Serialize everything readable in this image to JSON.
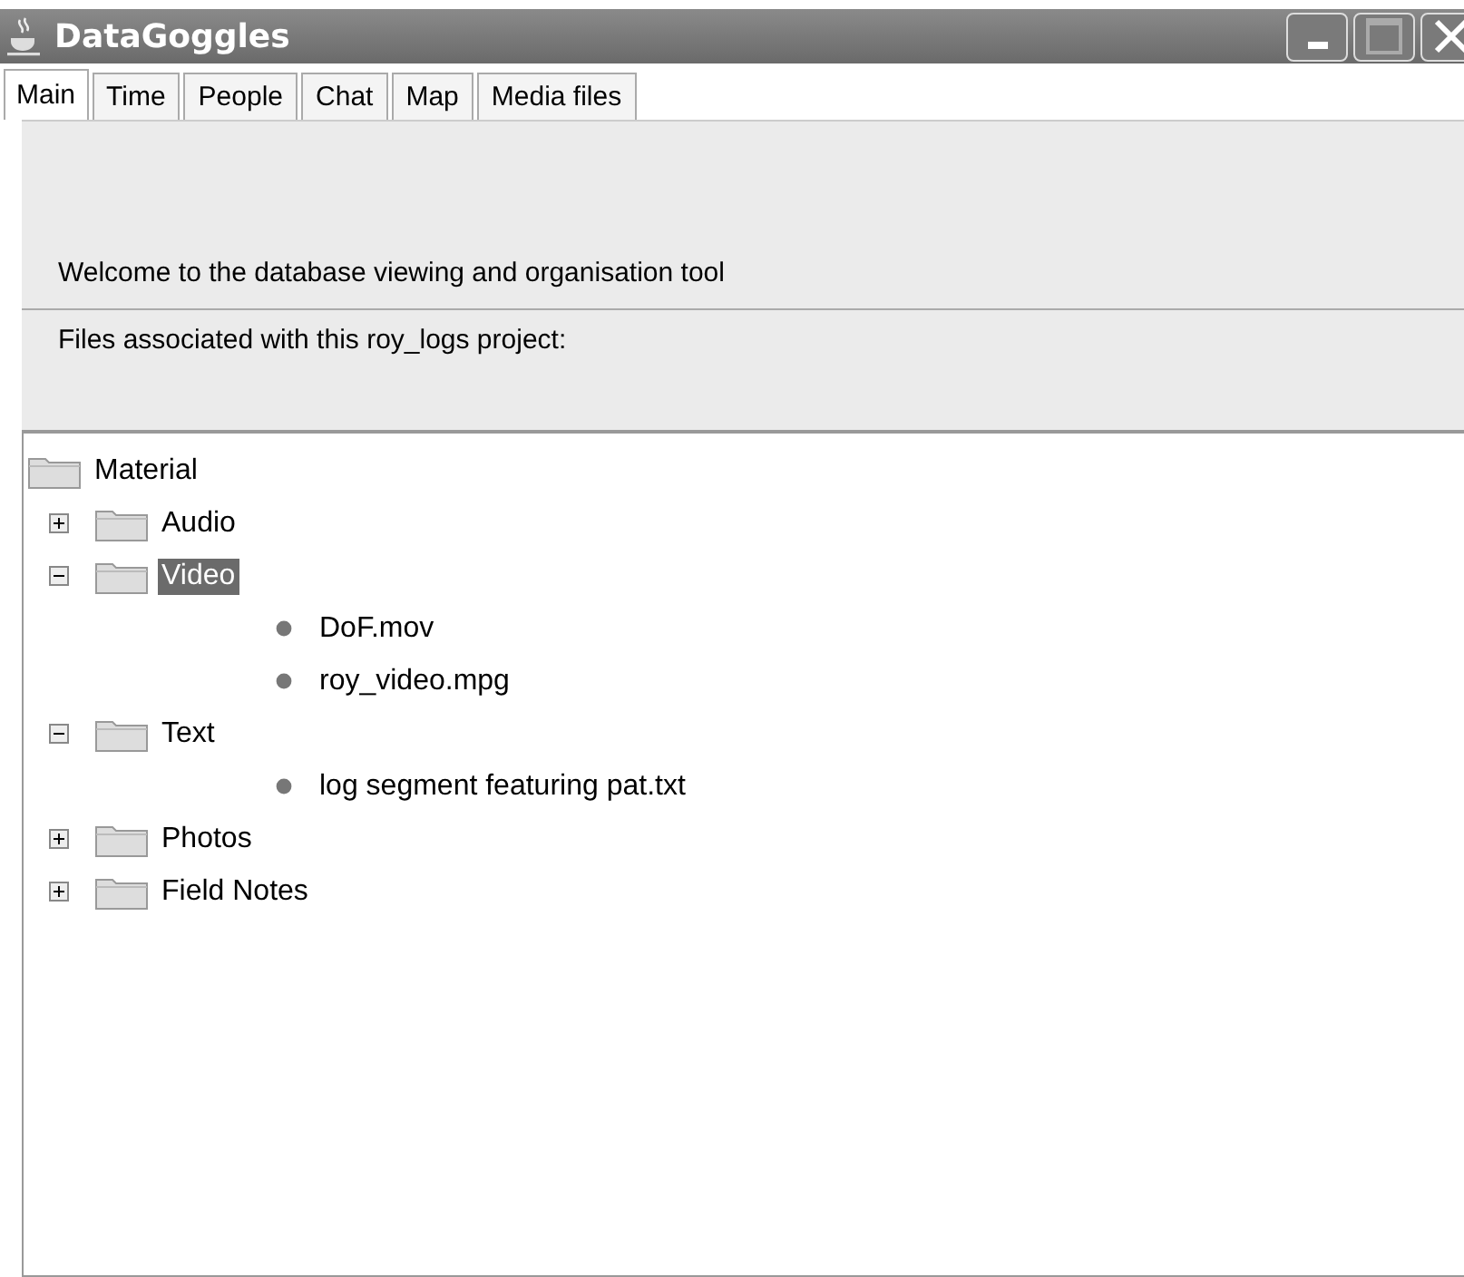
{
  "window": {
    "title": "DataGoggles"
  },
  "tabs": [
    {
      "label": "Main",
      "selected": true
    },
    {
      "label": "Time",
      "selected": false
    },
    {
      "label": "People",
      "selected": false
    },
    {
      "label": "Chat",
      "selected": false
    },
    {
      "label": "Map",
      "selected": false
    },
    {
      "label": "Media files",
      "selected": false
    }
  ],
  "panel": {
    "welcome": "Welcome to the database viewing and organisation tool",
    "files_label": "Files associated with this roy_logs project:"
  },
  "tree": {
    "label": "Material",
    "kind": "folder",
    "selected": false,
    "children": [
      {
        "label": "Audio",
        "kind": "folder",
        "expanded": false,
        "selected": false
      },
      {
        "label": "Video",
        "kind": "folder",
        "expanded": true,
        "selected": true,
        "children": [
          {
            "label": "DoF.mov",
            "kind": "file",
            "selected": false
          },
          {
            "label": "roy_video.mpg",
            "kind": "file",
            "selected": false
          }
        ]
      },
      {
        "label": "Text",
        "kind": "folder",
        "expanded": true,
        "selected": false,
        "children": [
          {
            "label": "log segment featuring pat.txt",
            "kind": "file",
            "selected": false
          }
        ]
      },
      {
        "label": "Photos",
        "kind": "folder",
        "expanded": false,
        "selected": false
      },
      {
        "label": "Field Notes",
        "kind": "folder",
        "expanded": false,
        "selected": false
      }
    ]
  }
}
